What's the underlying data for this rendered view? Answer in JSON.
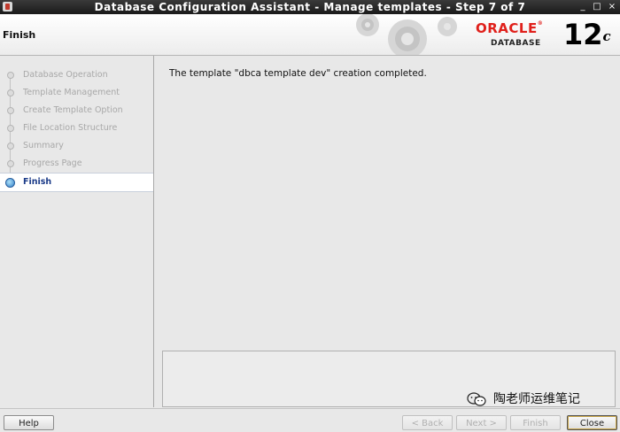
{
  "window": {
    "title": "Database Configuration Assistant - Manage templates - Step 7 of 7",
    "controls": [
      "_",
      "□",
      "×"
    ]
  },
  "header": {
    "step_title": "Finish",
    "logo": {
      "brand": "ORACLE",
      "registered": "®",
      "product": "DATABASE",
      "version": "12",
      "version_suffix": "c"
    }
  },
  "sidebar": {
    "steps": [
      {
        "label": "Database Operation"
      },
      {
        "label": "Template Management"
      },
      {
        "label": "Create Template Option"
      },
      {
        "label": "File Location Structure"
      },
      {
        "label": "Summary"
      },
      {
        "label": "Progress Page"
      },
      {
        "label": "Finish"
      }
    ],
    "active_index": 6
  },
  "main": {
    "message": "The template \"dbca template dev\" creation completed."
  },
  "buttons": {
    "help": "Help",
    "back": "< Back",
    "next": "Next >",
    "finish": "Finish",
    "close": "Close"
  },
  "watermark": {
    "text": "陶老师运维笔记"
  },
  "colors": {
    "oracle_red": "#e0201b",
    "active_step": "#1a3a88"
  }
}
